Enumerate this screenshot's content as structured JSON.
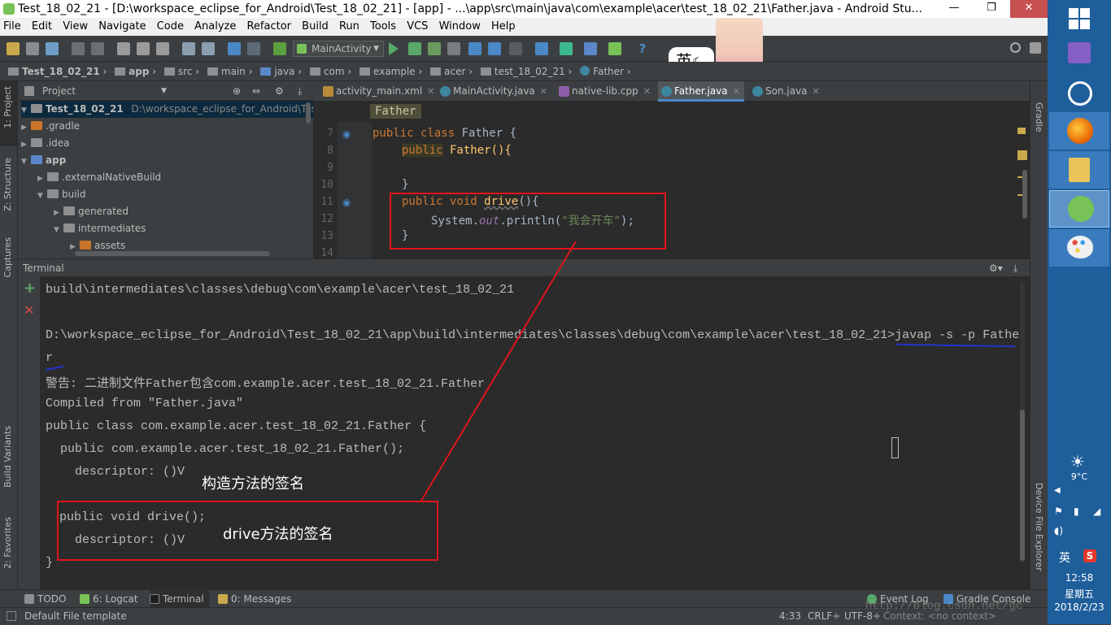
{
  "window": {
    "title": "Test_18_02_21 - [D:\\workspace_eclipse_for_Android\\Test_18_02_21] - [app] - ...\\app\\src\\main\\java\\com\\example\\acer\\test_18_02_21\\Father.java - Android Stu..."
  },
  "menu": [
    "File",
    "Edit",
    "View",
    "Navigate",
    "Code",
    "Analyze",
    "Refactor",
    "Build",
    "Run",
    "Tools",
    "VCS",
    "Window",
    "Help"
  ],
  "toolbar": {
    "run_config": "MainActivity"
  },
  "breadcrumb": [
    "Test_18_02_21",
    "app",
    "src",
    "main",
    "java",
    "com",
    "example",
    "acer",
    "test_18_02_21",
    "Father"
  ],
  "left_strip": {
    "project": "1: Project",
    "structure": "Z: Structure",
    "captures": "Captures",
    "build_variants": "Build Variants",
    "favorites": "2: Favorites"
  },
  "right_strip": {
    "gradle": "Gradle",
    "device_file_explorer": "Device File Explorer"
  },
  "project_panel": {
    "header": "Project",
    "root_name": "Test_18_02_21",
    "root_path": "D:\\workspace_eclipse_for_Android\\Test_18",
    "items": [
      ".gradle",
      ".idea",
      "app",
      ".externalNativeBuild",
      "build",
      "generated",
      "intermediates",
      "assets"
    ]
  },
  "editor_tabs": [
    "activity_main.xml",
    "MainActivity.java",
    "native-lib.cpp",
    "Father.java",
    "Son.java"
  ],
  "editor": {
    "breadcrumb_class": "Father",
    "line_numbers": [
      "7",
      "8",
      "9",
      "10",
      "11",
      "12",
      "13",
      "14"
    ],
    "code": {
      "l7_kw": "public class ",
      "l7_name": "Father {",
      "l8_kw": "public",
      "l8_rest": " Father(){",
      "l10": "}",
      "l11_kw": "public void ",
      "l11_fn": "drive",
      "l11_rest": "(){",
      "l12_a": "System.",
      "l12_out": "out",
      "l12_b": ".println(",
      "l12_str": "\"我会开车\"",
      "l12_c": ");",
      "l13": "}"
    }
  },
  "terminal": {
    "title": "Terminal",
    "lines": [
      "build\\intermediates\\classes\\debug\\com\\example\\acer\\test_18_02_21",
      "",
      "D:\\workspace_eclipse_for_Android\\Test_18_02_21\\app\\build\\intermediates\\classes\\debug\\com\\example\\acer\\test_18_02_21>javap -s -p Fathe",
      "r",
      "警告: 二进制文件Father包含com.example.acer.test_18_02_21.Father",
      "Compiled from \"Father.java\"",
      "public class com.example.acer.test_18_02_21.Father {",
      "  public com.example.acer.test_18_02_21.Father();",
      "    descriptor: ()V",
      "",
      "  public void drive();",
      "    descriptor: ()V",
      "}"
    ],
    "annotation_constructor": "构造方法的签名",
    "annotation_drive": "drive方法的签名"
  },
  "tool_windows": [
    "TODO",
    "6: Logcat",
    "Terminal",
    "0: Messages",
    "Event Log",
    "Gradle Console"
  ],
  "status": {
    "left": "Default File template",
    "position": "4:33",
    "line_sep": "CRLF÷",
    "encoding": "UTF-8÷",
    "context": "Context: <no context>",
    "watermark": "http://blog.csdn.net/gc"
  },
  "ime": {
    "lang": "英",
    "punct": "·,"
  },
  "taskbar": {
    "weather": "9°C",
    "ime": "英",
    "time": "12:58",
    "weekday": "星期五",
    "date": "2018/2/23"
  },
  "colors": {
    "highlight_box": "#e0141c",
    "annotation_line": "#e0141c",
    "underline": "#2233cc"
  }
}
